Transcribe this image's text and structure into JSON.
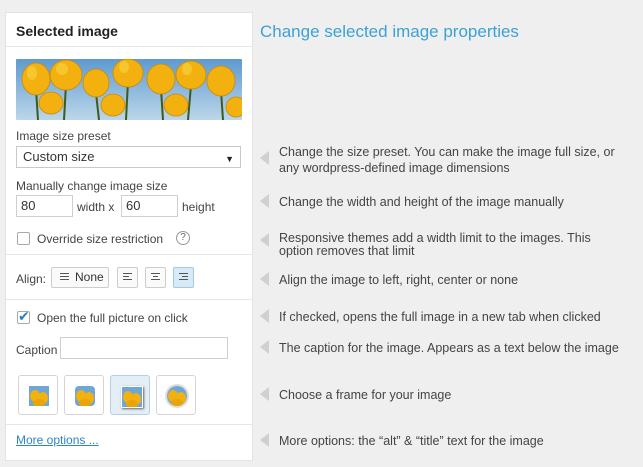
{
  "panel": {
    "title": "Selected image",
    "size_preset_label": "Image size preset",
    "size_preset_value": "Custom size",
    "manual_size_label": "Manually change image size",
    "width_value": "80",
    "width_unit": "width x",
    "height_value": "60",
    "height_unit": "height",
    "override_label": "Override size restriction",
    "help_glyph": "?",
    "align_label": "Align:",
    "align_none_label": "None",
    "open_full_label": "Open the full picture on click",
    "caption_label": "Caption",
    "caption_value": "",
    "more_options_link": "More options ..."
  },
  "descriptions": {
    "heading": "Change selected image properties",
    "size_preset_line1": "Change the size preset. You can make the image full size, or",
    "size_preset_line2": "any wordpress-defined image dimensions",
    "width_height": "Change the width and height of the image manually",
    "override_line1": "Responsive themes add a width limit to the images. This",
    "override_line2": "option removes that limit",
    "align": "Align the image to left, right, center or none",
    "open_full": "If checked, opens the full image in a new tab when clicked",
    "caption": "The caption for the image. Appears as a text below the image",
    "frame": "Choose a frame for your image",
    "more_options": "More options: the “alt” & “title” text for the image"
  },
  "state": {
    "override_checked": false,
    "open_full_checked": true,
    "selected_align": "right",
    "selected_frame": 3
  },
  "colors": {
    "heading": "#3aa2d6",
    "link": "#2f84c4",
    "tulip_yellow": "#f2b10f",
    "sky": "#7fb4dc"
  }
}
